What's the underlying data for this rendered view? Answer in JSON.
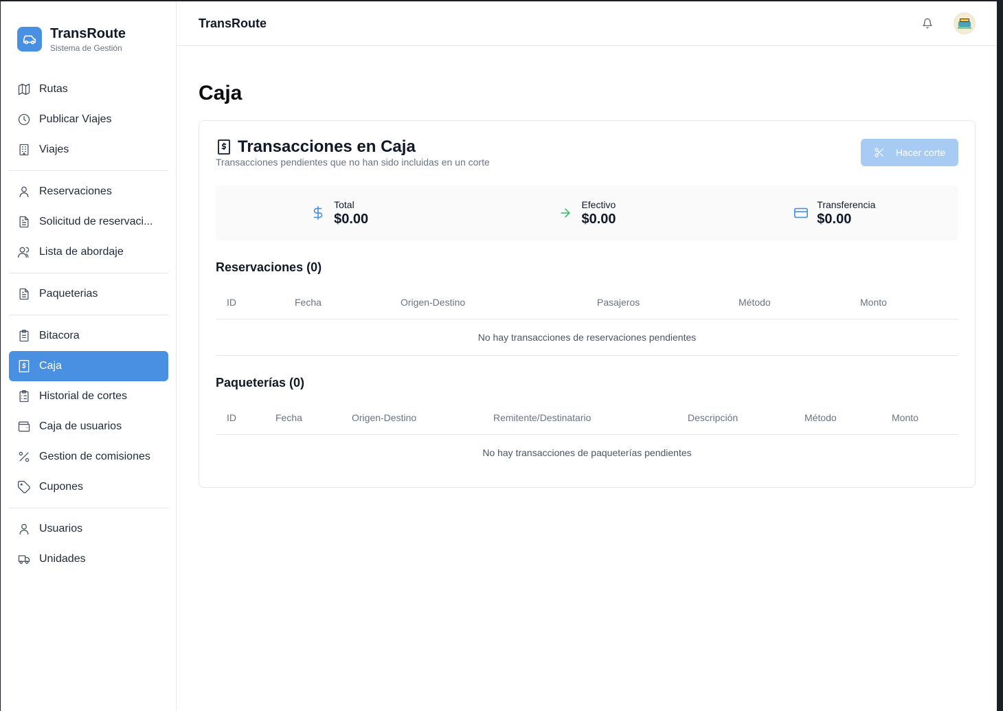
{
  "brand": {
    "name": "TransRoute",
    "subtitle": "Sistema de Gestión"
  },
  "sidebar": {
    "groups": [
      [
        {
          "label": "Rutas",
          "icon": "map-icon"
        },
        {
          "label": "Publicar Viajes",
          "icon": "clock-icon"
        },
        {
          "label": "Viajes",
          "icon": "building-icon"
        }
      ],
      [
        {
          "label": "Reservaciones",
          "icon": "user-icon"
        },
        {
          "label": "Solicitud de reservaci...",
          "icon": "file-text-icon"
        },
        {
          "label": "Lista de abordaje",
          "icon": "users-icon"
        }
      ],
      [
        {
          "label": "Paqueterias",
          "icon": "file-text-icon"
        }
      ],
      [
        {
          "label": "Bitacora",
          "icon": "clipboard-icon"
        },
        {
          "label": "Caja",
          "icon": "receipt-icon",
          "active": true
        },
        {
          "label": "Historial de cortes",
          "icon": "clipboard-list-icon"
        },
        {
          "label": "Caja de usuarios",
          "icon": "wallet-icon"
        },
        {
          "label": "Gestion de comisiones",
          "icon": "percent-icon"
        },
        {
          "label": "Cupones",
          "icon": "tag-icon"
        }
      ],
      [
        {
          "label": "Usuarios",
          "icon": "user-icon"
        },
        {
          "label": "Unidades",
          "icon": "truck-icon"
        }
      ]
    ]
  },
  "header": {
    "title": "TransRoute"
  },
  "page": {
    "title": "Caja"
  },
  "card": {
    "title": "Transacciones en Caja",
    "subtitle": "Transacciones pendientes que no han sido incluidas en un corte",
    "cut_button": "Hacer corte"
  },
  "summary": {
    "total": {
      "label": "Total",
      "value": "$0.00"
    },
    "cash": {
      "label": "Efectivo",
      "value": "$0.00"
    },
    "transfer": {
      "label": "Transferencia",
      "value": "$0.00"
    }
  },
  "reservations": {
    "title": "Reservaciones (0)",
    "columns": [
      "ID",
      "Fecha",
      "Origen-Destino",
      "Pasajeros",
      "Método",
      "Monto"
    ],
    "empty": "No hay transacciones de reservaciones pendientes"
  },
  "packages": {
    "title": "Paqueterías (0)",
    "columns": [
      "ID",
      "Fecha",
      "Origen-Destino",
      "Remitente/Destinatario",
      "Descripción",
      "Método",
      "Monto"
    ],
    "empty": "No hay transacciones de paqueterías pendientes"
  },
  "colors": {
    "accent": "#4a90e2",
    "button_disabled": "#a8cbf3",
    "success": "#22c55e"
  }
}
